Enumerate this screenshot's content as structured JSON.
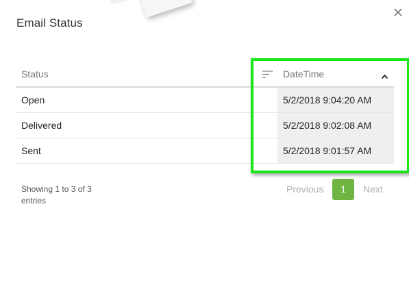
{
  "dialog": {
    "title": "Email Status",
    "close_icon": "close-icon"
  },
  "table": {
    "columns": [
      {
        "label": "Status"
      },
      {
        "label": "DateTime",
        "sort_icon": "sort-lines-icon",
        "sort_direction_icon": "chevron-up-icon"
      }
    ],
    "rows": [
      {
        "status": "Open",
        "datetime": "5/2/2018 9:04:20 AM"
      },
      {
        "status": "Delivered",
        "datetime": "5/2/2018 9:02:08 AM"
      },
      {
        "status": "Sent",
        "datetime": "5/2/2018 9:01:57 AM"
      }
    ]
  },
  "footer": {
    "info_text": "Showing 1 to 3 of 3 entries",
    "previous_label": "Previous",
    "current_page": "1",
    "next_label": "Next"
  },
  "colors": {
    "highlight": "#19e619",
    "active_page": "#6fb543",
    "sorted_column_bg": "#efefef"
  }
}
